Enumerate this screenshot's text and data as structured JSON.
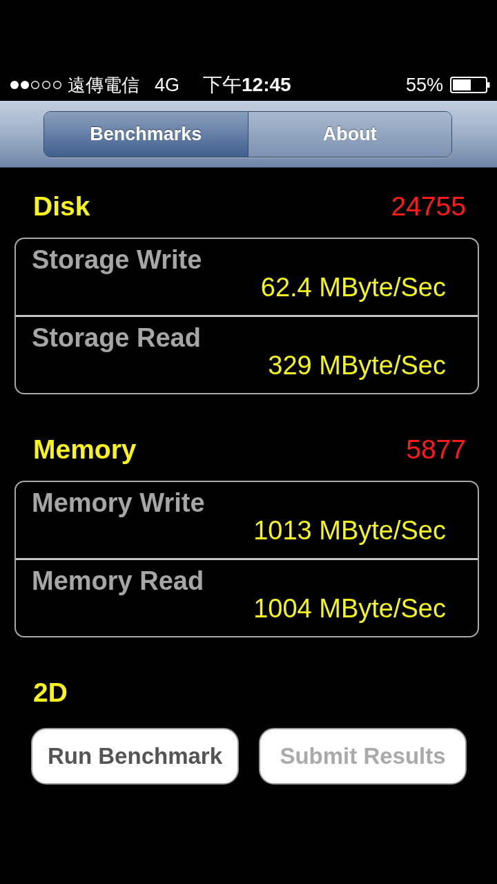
{
  "status_bar": {
    "carrier": "遠傳電信",
    "network": "4G",
    "time": "下午**12:45**",
    "battery": "55%"
  },
  "tabs": [
    {
      "label": "Benchmarks",
      "selected": true
    },
    {
      "label": "About",
      "selected": false
    }
  ],
  "sections": [
    {
      "title": "Disk",
      "score": "24755",
      "rows": [
        {
          "label": "Storage Write",
          "value": "62.4 MByte/Sec"
        },
        {
          "label": "Storage Read",
          "value": "329 MByte/Sec"
        }
      ]
    },
    {
      "title": "Memory",
      "score": "5877",
      "rows": [
        {
          "label": "Memory Write",
          "value": "1013 MByte/Sec"
        },
        {
          "label": "Memory Read",
          "value": "1004 MByte/Sec"
        }
      ]
    },
    {
      "title": "2D"
    }
  ],
  "buttons": [
    {
      "label": "Run Benchmark",
      "disabled": false
    },
    {
      "label": "Submit Results",
      "disabled": true
    }
  ]
}
